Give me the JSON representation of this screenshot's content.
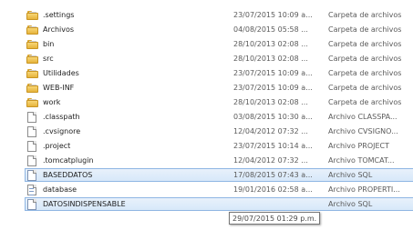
{
  "files": [
    {
      "name": ".settings",
      "date": "23/07/2015 10:09 a...",
      "type": "Carpeta de archivos",
      "icon": "folder-icon",
      "selected": false
    },
    {
      "name": "Archivos",
      "date": "04/08/2015 05:58 ...",
      "type": "Carpeta de archivos",
      "icon": "folder-icon",
      "selected": false
    },
    {
      "name": "bin",
      "date": "28/10/2013 02:08 ...",
      "type": "Carpeta de archivos",
      "icon": "folder-icon",
      "selected": false
    },
    {
      "name": "src",
      "date": "28/10/2013 02:08 ...",
      "type": "Carpeta de archivos",
      "icon": "folder-icon",
      "selected": false
    },
    {
      "name": "Utilidades",
      "date": "23/07/2015 10:09 a...",
      "type": "Carpeta de archivos",
      "icon": "folder-icon",
      "selected": false
    },
    {
      "name": "WEB-INF",
      "date": "23/07/2015 10:09 a...",
      "type": "Carpeta de archivos",
      "icon": "folder-icon",
      "selected": false
    },
    {
      "name": "work",
      "date": "28/10/2013 02:08 ...",
      "type": "Carpeta de archivos",
      "icon": "folder-icon",
      "selected": false
    },
    {
      "name": ".classpath",
      "date": "03/08/2015 10:30 a...",
      "type": "Archivo CLASSPA...",
      "icon": "file-icon",
      "selected": false
    },
    {
      "name": ".cvsignore",
      "date": "12/04/2012 07:32 ...",
      "type": "Archivo CVSIGNO...",
      "icon": "file-icon",
      "selected": false
    },
    {
      "name": ".project",
      "date": "23/07/2015 10:14 a...",
      "type": "Archivo PROJECT",
      "icon": "file-icon",
      "selected": false
    },
    {
      "name": ".tomcatplugin",
      "date": "12/04/2012 07:32 ...",
      "type": "Archivo TOMCAT...",
      "icon": "file-icon",
      "selected": false
    },
    {
      "name": "BASEDDATOS",
      "date": "17/08/2015 07:43 a...",
      "type": "Archivo SQL",
      "icon": "sql-file-icon",
      "selected": true
    },
    {
      "name": "database",
      "date": "19/01/2016 02:58 a...",
      "type": "Archivo PROPERTI...",
      "icon": "properties-file-icon",
      "selected": false
    },
    {
      "name": "DATOSINDISPENSABLE",
      "date": "",
      "type": "Archivo SQL",
      "icon": "sql-file-icon",
      "selected": true
    }
  ],
  "tooltip": {
    "text": "29/07/2015 01:29 p.m."
  }
}
